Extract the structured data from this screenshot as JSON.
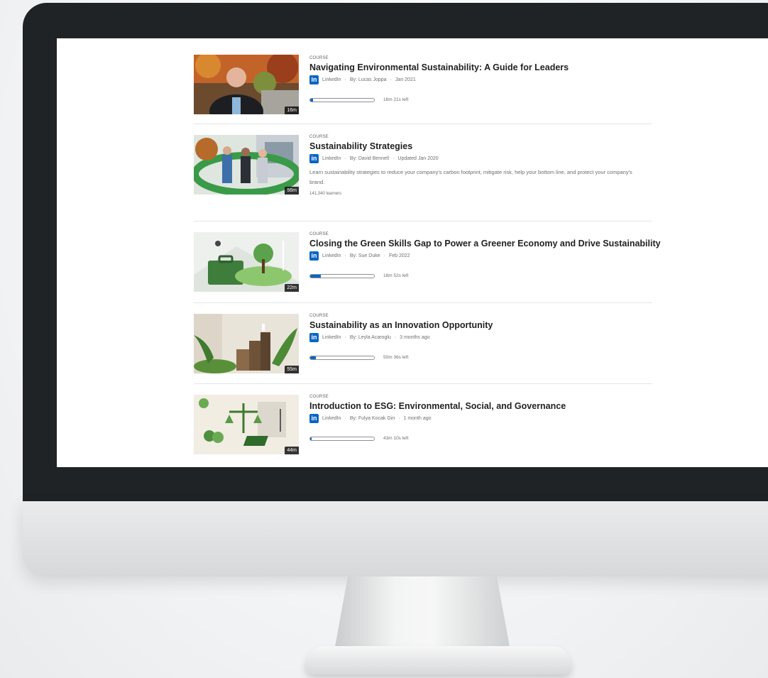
{
  "courses": [
    {
      "kicker": "COURSE",
      "title": "Navigating Environmental Sustainability: A Guide for Leaders",
      "provider": "LinkedIn",
      "author": "By: Lucas Joppa",
      "date": "Jan 2021",
      "duration": "16m",
      "progress": 0.04,
      "time_left": "16m 21s left",
      "thumb_theme": "portrait"
    },
    {
      "kicker": "COURSE",
      "title": "Sustainability Strategies",
      "provider": "LinkedIn",
      "author": "By: David Bennell",
      "date": "Updated Jan 2020",
      "duration": "56m",
      "description": "Learn sustainability strategies to reduce your company's carbon footprint, mitigate risk, help your bottom line, and protect your company's brand.",
      "learners": "141,340 learners",
      "thumb_theme": "team"
    },
    {
      "kicker": "COURSE",
      "title": "Closing the Green Skills Gap to Power a Greener Economy and Drive Sustainability",
      "provider": "LinkedIn",
      "author": "By: Sue Duke",
      "date": "Feb 2022",
      "duration": "22m",
      "progress": 0.17,
      "time_left": "18m 52s left",
      "thumb_theme": "briefcase"
    },
    {
      "kicker": "COURSE",
      "title": "Sustainability as an Innovation Opportunity",
      "provider": "LinkedIn",
      "author": "By: Leyla Acaroglu",
      "date": "3 months ago",
      "duration": "55m",
      "progress": 0.09,
      "time_left": "50m 36s left",
      "thumb_theme": "plants"
    },
    {
      "kicker": "COURSE",
      "title": "Introduction to ESG: Environmental, Social, and Governance",
      "provider": "LinkedIn",
      "author": "By: Fulya Kocak Gin",
      "date": "1 month ago",
      "duration": "44m",
      "progress": 0.02,
      "time_left": "43m 10s left",
      "thumb_theme": "esg"
    }
  ],
  "colors": {
    "linkedin_blue": "#0a66c2",
    "bezel": "#1f2326"
  }
}
